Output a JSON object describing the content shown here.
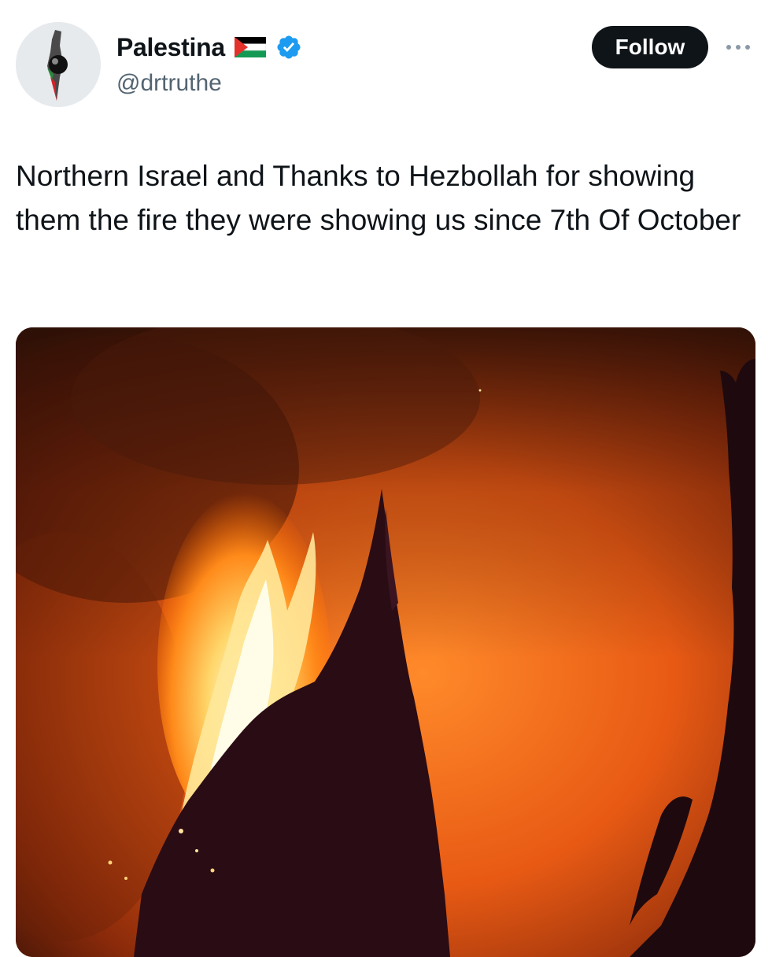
{
  "tweet": {
    "author": {
      "display_name": "Palestina",
      "handle": "@drtruthe",
      "avatar_icon": "palestine-map-avatar-icon",
      "flag_icon": "palestine-flag-icon",
      "verified_icon": "verified-badge-icon",
      "verified_color": "#1d9bf0"
    },
    "follow_label": "Follow",
    "more_icon": "more-options-icon",
    "text": "Northern Israel and Thanks to Hezbollah for showing them the fire they were showing us since 7th Of October",
    "media": {
      "type": "image",
      "subject": "trees silhouetted against a large forest fire at night"
    }
  },
  "colors": {
    "text_primary": "#0f1419",
    "text_secondary": "#536471",
    "follow_bg": "#0f1419",
    "follow_text": "#ffffff",
    "accent": "#1d9bf0"
  }
}
